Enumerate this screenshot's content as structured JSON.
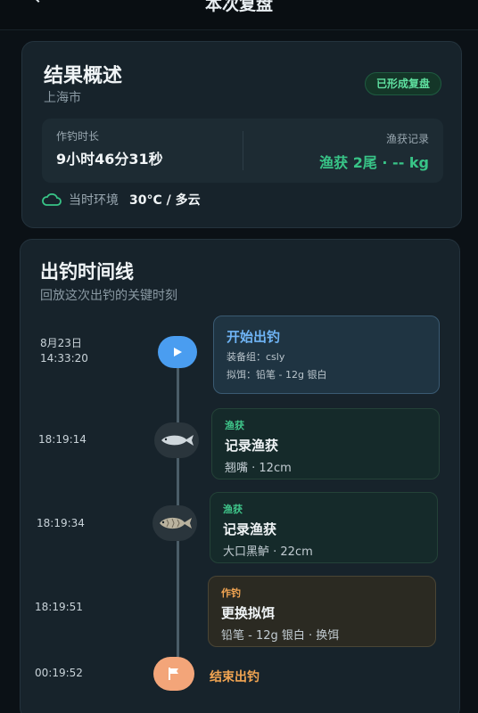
{
  "header": {
    "title": "本次复盘"
  },
  "summary": {
    "title": "结果概述",
    "city": "上海市",
    "badge": "已形成复盘",
    "duration_label": "作钓时长",
    "duration_value": "9小时46分31秒",
    "catch_label": "渔获记录",
    "catch_value": "渔获 2尾 · -- kg",
    "env_label": "当时环境",
    "env_value": "30°C / 多云"
  },
  "timeline": {
    "title": "出钓时间线",
    "subtitle": "回放这次出钓的关键时刻",
    "events": [
      {
        "date": "8月23日",
        "time": "14:33:20",
        "title": "开始出钓",
        "line1": "装备组：csly",
        "line2": "拟饵：铅笔 - 12g 银白"
      },
      {
        "time": "18:19:14",
        "tag": "渔获",
        "title": "记录渔获",
        "detail": "翘嘴 · 12cm"
      },
      {
        "time": "18:19:34",
        "tag": "渔获",
        "title": "记录渔获",
        "detail": "大口黑鲈 · 22cm"
      },
      {
        "time": "18:19:51",
        "tag": "作钓",
        "title": "更换拟饵",
        "detail": "铅笔 - 12g 银白 · 换饵"
      },
      {
        "time": "00:19:52",
        "title": "结束出钓"
      }
    ]
  },
  "colors": {
    "accent_green": "#38c487",
    "accent_blue": "#4a9df0",
    "accent_orange": "#f2a552"
  }
}
